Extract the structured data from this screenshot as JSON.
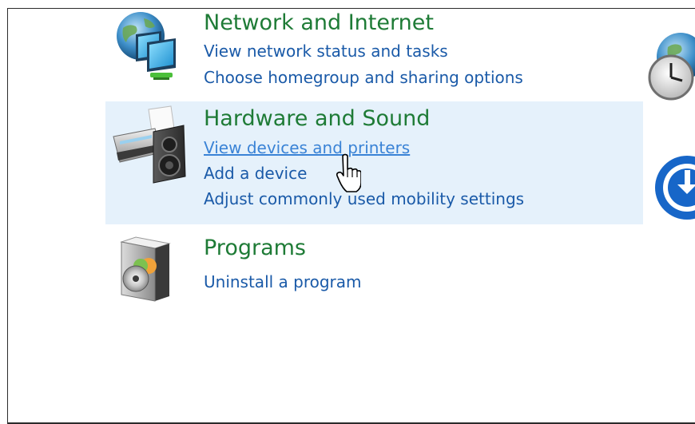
{
  "categories": [
    {
      "title": "Network and Internet",
      "icon": "network-globe-monitors-icon",
      "links": [
        "View network status and tasks",
        "Choose homegroup and sharing options"
      ]
    },
    {
      "title": "Hardware and Sound",
      "icon": "printer-speaker-icon",
      "highlighted": true,
      "links": [
        "View devices and printers",
        "Add a device",
        "Adjust commonly used mobility settings"
      ]
    },
    {
      "title": "Programs",
      "icon": "programs-disc-box-icon",
      "links": [
        "Uninstall a program"
      ]
    }
  ],
  "side_icons": [
    "clock-globe-icon",
    "ease-of-access-icon"
  ],
  "colors": {
    "title_green": "#1e7b36",
    "link_blue": "#1a5aa8",
    "link_hover": "#3a83d6",
    "highlight_bg": "#e5f1fb"
  },
  "cursor": "hand-pointer-cursor"
}
